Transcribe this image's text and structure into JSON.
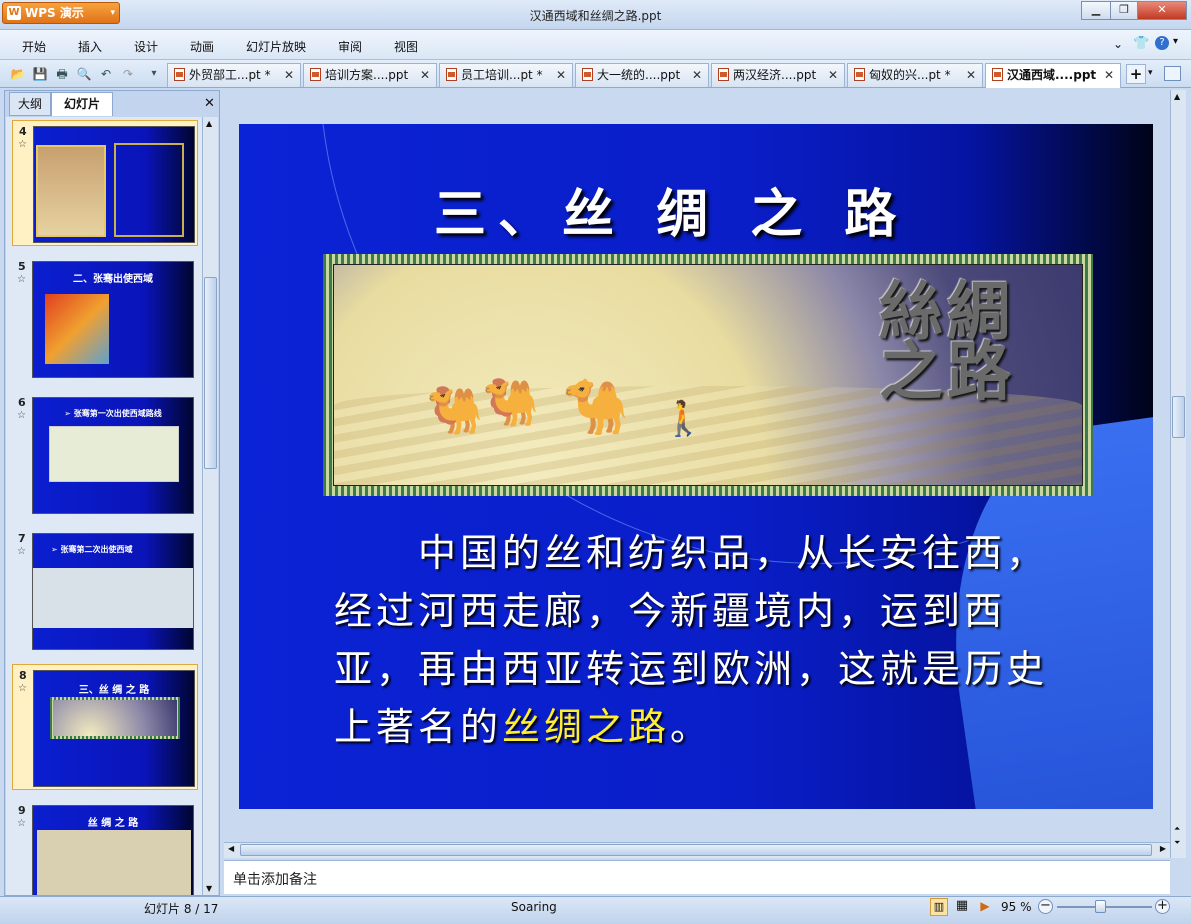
{
  "app": {
    "name": "WPS 演示",
    "window_title": "汉通西域和丝绸之路.ppt"
  },
  "menu": [
    "开始",
    "插入",
    "设计",
    "动画",
    "幻灯片放映",
    "审阅",
    "视图"
  ],
  "tabs": [
    {
      "label": "外贸部工...pt *",
      "active": false
    },
    {
      "label": "培训方案....ppt",
      "active": false
    },
    {
      "label": "员工培训...pt *",
      "active": false
    },
    {
      "label": "大一统的....ppt",
      "active": false
    },
    {
      "label": "两汉经济....ppt",
      "active": false
    },
    {
      "label": "匈奴的兴...pt *",
      "active": false
    },
    {
      "label": "汉通西域....ppt",
      "active": true
    }
  ],
  "panel": {
    "tab_outline": "大纲",
    "tab_slides": "幻灯片"
  },
  "thumbnails": [
    {
      "num": "4",
      "title": ""
    },
    {
      "num": "5",
      "title": "二、张骞出使西域"
    },
    {
      "num": "6",
      "title": "➢ 张骞第一次出使西域路线"
    },
    {
      "num": "7",
      "title": "➢ 张骞第二次出使西域"
    },
    {
      "num": "8",
      "title": "三、丝 绸 之 路"
    },
    {
      "num": "9",
      "title": "丝 绸 之 路"
    }
  ],
  "slide": {
    "title": "三、丝 绸 之 路",
    "logo_text": "絲綢之路",
    "body_prefix": "中国的丝和纺织品，从长安往西，经过河西走廊，今新疆境内，运到西亚，再由西亚转运到欧洲，这就是历史上著名的",
    "body_highlight": "丝绸之路",
    "body_suffix": "。"
  },
  "notes": {
    "placeholder": "单击添加备注"
  },
  "status": {
    "slide_counter": "幻灯片 8 / 17",
    "theme": "Soaring",
    "zoom": "95 %"
  },
  "colors": {
    "accent": "#e0731a",
    "slide_bg": "#0b23d6",
    "highlight": "#ffee30"
  }
}
